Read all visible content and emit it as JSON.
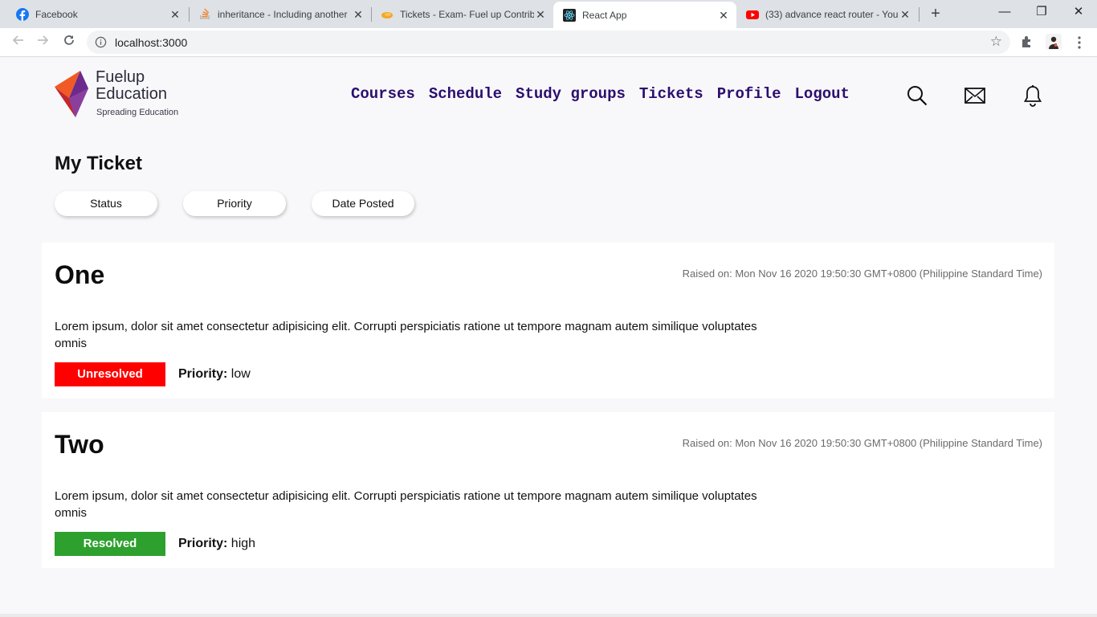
{
  "browser": {
    "tabs": [
      {
        "title": "Facebook",
        "icon": "facebook-icon"
      },
      {
        "title": "inheritance - Including another",
        "icon": "stackoverflow-icon"
      },
      {
        "title": "Tickets - Exam- Fuel up Contrib",
        "icon": "orange-blob-icon"
      },
      {
        "title": "React App",
        "icon": "react-icon"
      },
      {
        "title": "(33) advance react router - You",
        "icon": "youtube-icon"
      }
    ],
    "url": "localhost:3000"
  },
  "brand": {
    "name_line1": "Fuelup",
    "name_line2": "Education",
    "tagline": "Spreading Education",
    "colors": {
      "orange": "#f15a24",
      "purple": "#6b2a8c",
      "red": "#c1272d"
    }
  },
  "nav": {
    "items": [
      "Courses",
      "Schedule",
      "Study groups",
      "Tickets",
      "Profile",
      "Logout"
    ],
    "color": "#2c0e6e"
  },
  "page": {
    "title": "My Ticket",
    "filters": [
      "Status",
      "Priority",
      "Date Posted"
    ]
  },
  "tickets": [
    {
      "name": "One",
      "raised": "Raised on: Mon Nov 16 2020 19:50:30 GMT+0800 (Philippine Standard Time)",
      "description": "Lorem ipsum, dolor sit amet consectetur adipisicing elit. Corrupti perspiciatis ratione ut tempore magnam autem similique voluptates omnis",
      "status": "Unresolved",
      "status_color": "#ff0000",
      "priority_label": "Priority:",
      "priority": "low"
    },
    {
      "name": "Two",
      "raised": "Raised on: Mon Nov 16 2020 19:50:30 GMT+0800 (Philippine Standard Time)",
      "description": "Lorem ipsum, dolor sit amet consectetur adipisicing elit. Corrupti perspiciatis ratione ut tempore magnam autem similique voluptates omnis",
      "status": "Resolved",
      "status_color": "#2ea02e",
      "priority_label": "Priority:",
      "priority": "high"
    }
  ]
}
